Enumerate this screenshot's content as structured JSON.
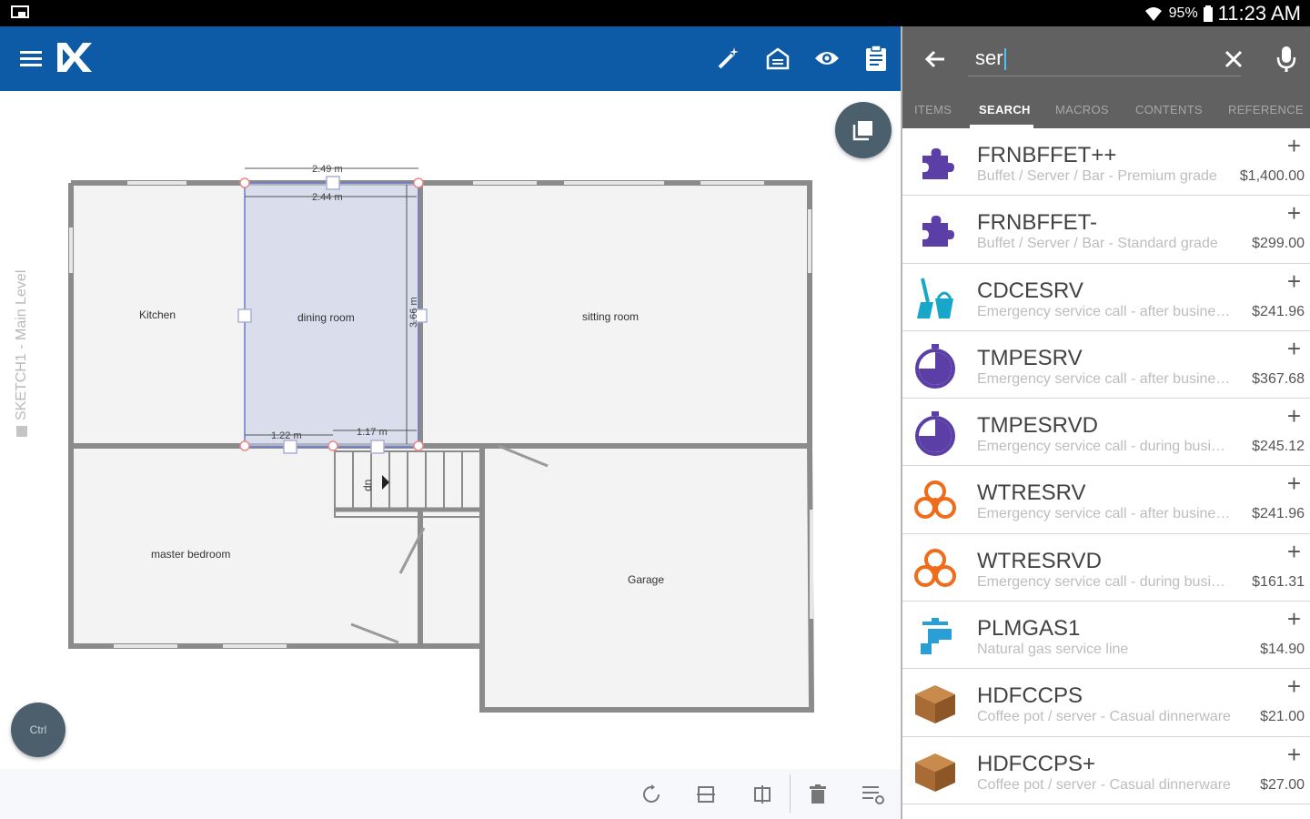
{
  "status": {
    "battery": "95%",
    "time": "11:23 AM"
  },
  "sketch": {
    "level_label": "SKETCH1 - Main Level",
    "ctrl_label": "Ctrl"
  },
  "floorplan": {
    "rooms": [
      "Kitchen",
      "dining room",
      "sitting room",
      "master bedroom",
      "Garage"
    ],
    "dims": [
      "2.49 m",
      "2.44 m",
      "3.66 m",
      "1.22 m",
      "1.17 m"
    ],
    "stairs_label": "dn"
  },
  "search": {
    "query": "ser"
  },
  "tabs": [
    {
      "label": "ITEMS"
    },
    {
      "label": "SEARCH"
    },
    {
      "label": "MACROS"
    },
    {
      "label": "CONTENTS"
    },
    {
      "label": "REFERENCE"
    }
  ],
  "items": [
    {
      "code": "FRNBFFET++",
      "desc": "Buffet / Server / Bar - Premium grade",
      "price": "$1,400.00",
      "icon": "puzzle-icon"
    },
    {
      "code": "FRNBFFET-",
      "desc": "Buffet / Server / Bar - Standard grade",
      "price": "$299.00",
      "icon": "puzzle-icon"
    },
    {
      "code": "CDCESRV",
      "desc": "Emergency service call - after business hours",
      "price": "$241.96",
      "icon": "cleaning-icon"
    },
    {
      "code": "TMPESRV",
      "desc": "Emergency service call - after business hours",
      "price": "$367.68",
      "icon": "stopwatch-icon"
    },
    {
      "code": "TMPESRVD",
      "desc": "Emergency service call - during business hours",
      "price": "$245.12",
      "icon": "stopwatch-icon"
    },
    {
      "code": "WTRESRV",
      "desc": "Emergency service call - after business hours",
      "price": "$241.96",
      "icon": "biohazard-icon"
    },
    {
      "code": "WTRESRVD",
      "desc": "Emergency service call - during business hours",
      "price": "$161.31",
      "icon": "biohazard-icon"
    },
    {
      "code": "PLMGAS1",
      "desc": "Natural gas service line",
      "price": "$14.90",
      "icon": "faucet-icon"
    },
    {
      "code": "HDFCCPS",
      "desc": "Coffee pot / server - Casual dinnerware",
      "price": "$21.00",
      "icon": "box-icon"
    },
    {
      "code": "HDFCCPS+",
      "desc": "Coffee pot / server - Casual dinnerware",
      "price": "$27.00",
      "icon": "box-icon"
    }
  ],
  "colors": {
    "appbar": "#0d5aa7",
    "panel_header": "#616161",
    "accent": "#4fc3f7"
  }
}
